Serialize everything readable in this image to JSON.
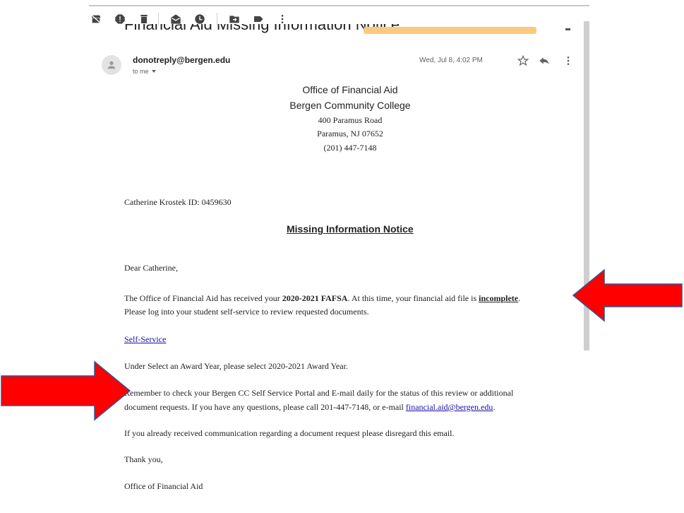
{
  "email": {
    "subject": "Financial Aid Missing Information Notice",
    "sender": "donotreply@bergen.edu",
    "to": "to me",
    "date": "Wed, Jul 8, 4:02 PM"
  },
  "letterhead": {
    "office": "Office of Financial Aid",
    "college": "Bergen Community College",
    "street": "400 Paramus Road",
    "city": "Paramus, NJ 07652",
    "phone": "(201) 447-7148"
  },
  "body": {
    "student_line": "Catherine Krostek ID: 0459630",
    "notice_title": "Missing Information Notice",
    "greeting": "Dear Catherine,",
    "p1_a": "The Office of Financial Aid has received your ",
    "p1_fafsa": "2020-2021 FAFSA",
    "p1_b": ". At this time, your financial aid file is ",
    "p1_incomplete": "incomplete",
    "p1_c": ".",
    "p1_line2": "Please log into your student self-service to review requested documents.",
    "self_service_link": "Self-Service",
    "award_year_line": "Under Select an Award Year, please select 2020-2021 Award Year.",
    "p3_line1": "Remember to check your Bergen CC Self Service Portal and E-mail daily for the status of this review or additional",
    "p3_line2_a": "document requests. If you have any questions, please call 201-447-7148, or e-mail ",
    "p3_email": "financial.aid@bergen.edu",
    "p3_line2_b": ".",
    "disregard_line": "If you already received communication regarding a document request please disregard this email.",
    "thanks": "Thank you,",
    "signature": "Office of Financial Aid"
  },
  "icons": {
    "toolbar": [
      "archive-off-icon",
      "report-spam-icon",
      "delete-icon",
      "mark-unread-icon",
      "snooze-icon",
      "move-to-icon",
      "label-icon",
      "more-vert-icon"
    ],
    "header": [
      "star-icon",
      "reply-icon",
      "more-vert-icon"
    ]
  },
  "colors": {
    "arrow": "#ff0000",
    "link": "#1a0dab",
    "subject_tag": "#fbc97e"
  }
}
